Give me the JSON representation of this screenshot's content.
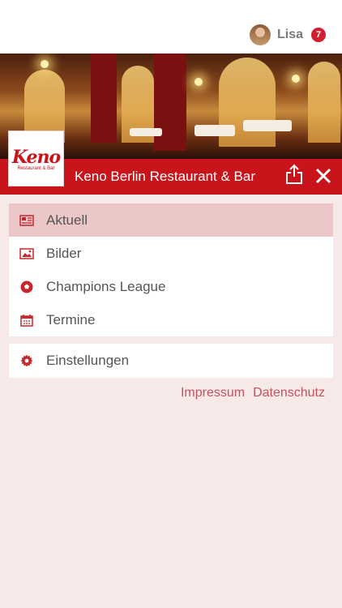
{
  "user": {
    "name": "Lisa",
    "notifications": "7"
  },
  "business": {
    "name": "Keno Berlin Restaurant & Bar",
    "logo_word": "Keno",
    "logo_sub": "Restaurant & Bar"
  },
  "menu": {
    "items": [
      {
        "label": "Aktuell",
        "icon": "newspaper-icon",
        "active": true
      },
      {
        "label": "Bilder",
        "icon": "image-icon"
      },
      {
        "label": "Champions League",
        "icon": "soccer-ball-icon"
      },
      {
        "label": "Termine",
        "icon": "calendar-icon"
      }
    ],
    "settings": {
      "label": "Einstellungen",
      "icon": "gear-icon"
    }
  },
  "footer": {
    "impressum": "Impressum",
    "datenschutz": "Datenschutz"
  },
  "colors": {
    "brand_red": "#c8141a",
    "active_bg": "#ecc7c7",
    "icon_red": "#c8262c",
    "page_bg": "#f8e9e9"
  }
}
